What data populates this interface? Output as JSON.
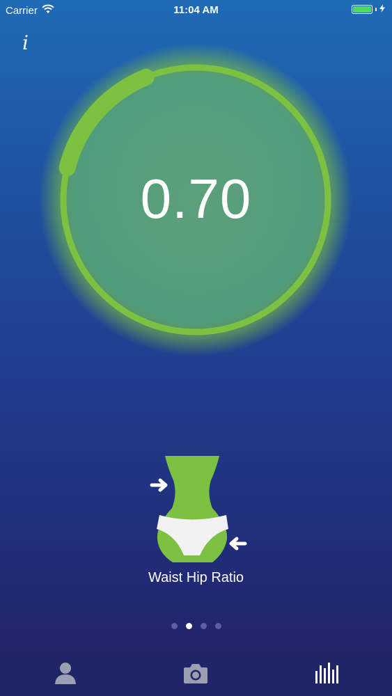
{
  "status_bar": {
    "carrier": "Carrier",
    "time": "11:04 AM"
  },
  "info_button": {
    "label": "i"
  },
  "gauge": {
    "value": "0.70",
    "progress": 0.15,
    "color": "#7cc142"
  },
  "body_shape": {
    "label": "Waist Hip Ratio"
  },
  "pager": {
    "pages": 4,
    "active_index": 1
  },
  "tab_bar": {
    "tabs": [
      {
        "icon": "person-icon"
      },
      {
        "icon": "camera-icon"
      },
      {
        "icon": "bar-chart-icon"
      }
    ]
  }
}
